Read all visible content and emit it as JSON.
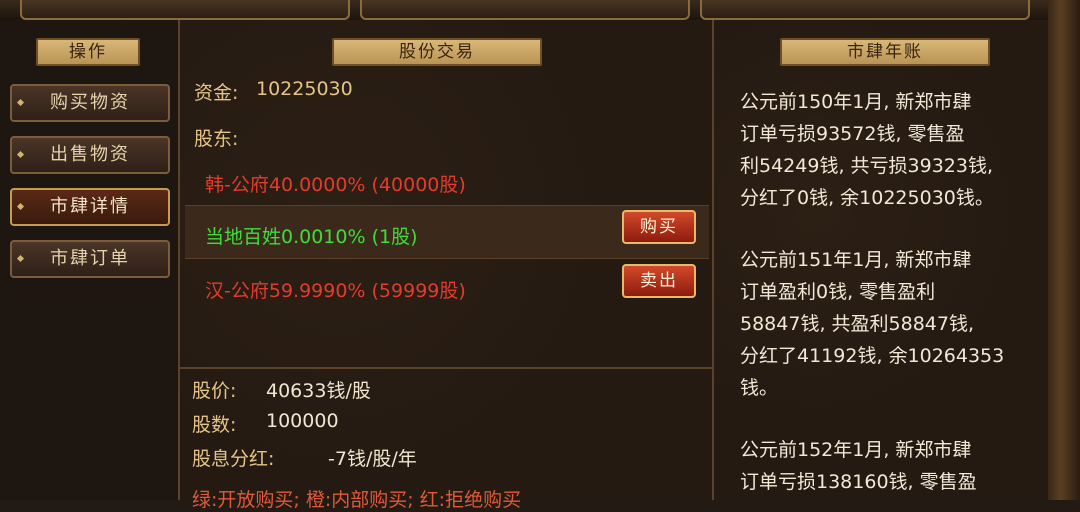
{
  "left_panel": {
    "title": "操作",
    "menu": [
      {
        "label": "购买物资"
      },
      {
        "label": "出售物资"
      },
      {
        "label": "市肆详情"
      },
      {
        "label": "市肆订单"
      }
    ]
  },
  "middle_panel": {
    "title": "股份交易",
    "funds_label": "资金:",
    "funds_value": "10225030",
    "shareholders_label": "股东:",
    "shareholders": [
      {
        "text": "韩-公府40.0000% (40000股)",
        "color": "#e43b2c"
      },
      {
        "text": "当地百姓0.0010% (1股)",
        "color": "#3fdc3a"
      },
      {
        "text": "汉-公府59.9990% (59999股)",
        "color": "#e43b2c"
      }
    ],
    "buy_label": "购买",
    "sell_label": "卖出",
    "share_price_label": "股价:",
    "share_price_value": "40633钱/股",
    "share_count_label": "股数:",
    "share_count_value": "100000",
    "dividend_label": "股息分红:",
    "dividend_value": "-7钱/股/年",
    "legend": "绿:开放购买; 橙:内部购买; 红:拒绝购买"
  },
  "right_panel": {
    "title": "市肆年账",
    "entries": [
      "公元前150年1月, 新郑市肆\n订单亏损93572钱, 零售盈\n利54249钱, 共亏损39323钱,\n分红了0钱, 余10225030钱。",
      "公元前151年1月, 新郑市肆\n订单盈利0钱, 零售盈利\n58847钱, 共盈利58847钱,\n分红了41192钱, 余10264353\n钱。",
      "公元前152年1月, 新郑市肆\n订单亏损138160钱, 零售盈"
    ]
  }
}
